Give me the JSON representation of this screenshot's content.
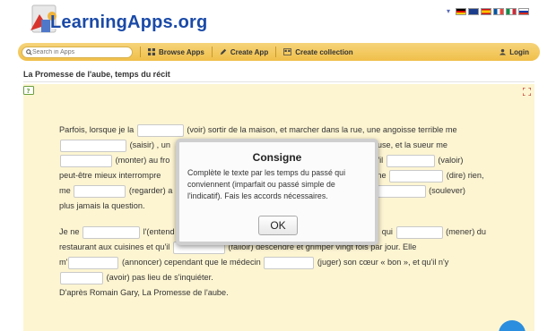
{
  "header": {
    "logo_text": "LearningApps.org",
    "flags": [
      "de",
      "gb",
      "es",
      "fr",
      "it",
      "ru"
    ]
  },
  "toolbar": {
    "search_placeholder": "Search in Apps",
    "browse_label": "Browse Apps",
    "create_label": "Create App",
    "collection_label": "Create collection",
    "login_label": "Login"
  },
  "page": {
    "title": "La Promesse de l'aube, temps du récit"
  },
  "exercise": {
    "p1": {
      "s1": "Parfois, lorsque je la",
      "s2": "(voir) sortir de la maison, et marcher dans la rue, une angoisse terrible me",
      "s3": "(saisir) , un",
      "s4": "freuse, et la sueur me",
      "s5": "(monter) au fro",
      "s6": "r) qu'il",
      "s7": "(valoir)",
      "s8": "peut-être mieux interrompre",
      "s9": "Elle ne",
      "s10": "(dire) rien,",
      "s11": "me",
      "s12": "(regarder) a",
      "s13": "(soulever)",
      "s14": "plus jamais la question."
    },
    "p2": {
      "s1": "Je ne",
      "s2": "l'(entend",
      "s3": "qui",
      "s4": "(mener) du",
      "s5": "restaurant aux cuisines et qu'il",
      "s6": "(falloir) descendre et grimper vingt fois par jour. Elle",
      "s7": "m'",
      "s8": "(annoncer) cependant que le médecin",
      "s9": "(juger) son cœur « bon », et qu'il n'y",
      "s10": "(avoir) pas lieu de s'inquiéter.",
      "s11": "D'après Romain Gary, La Promesse de l'aube."
    }
  },
  "modal": {
    "title": "Consigne",
    "body": "Complète le texte par les temps du passé qui conviennent (imparfait ou passé simple de l'indicatif). Fais les accords nécessaires.",
    "ok_label": "OK"
  }
}
